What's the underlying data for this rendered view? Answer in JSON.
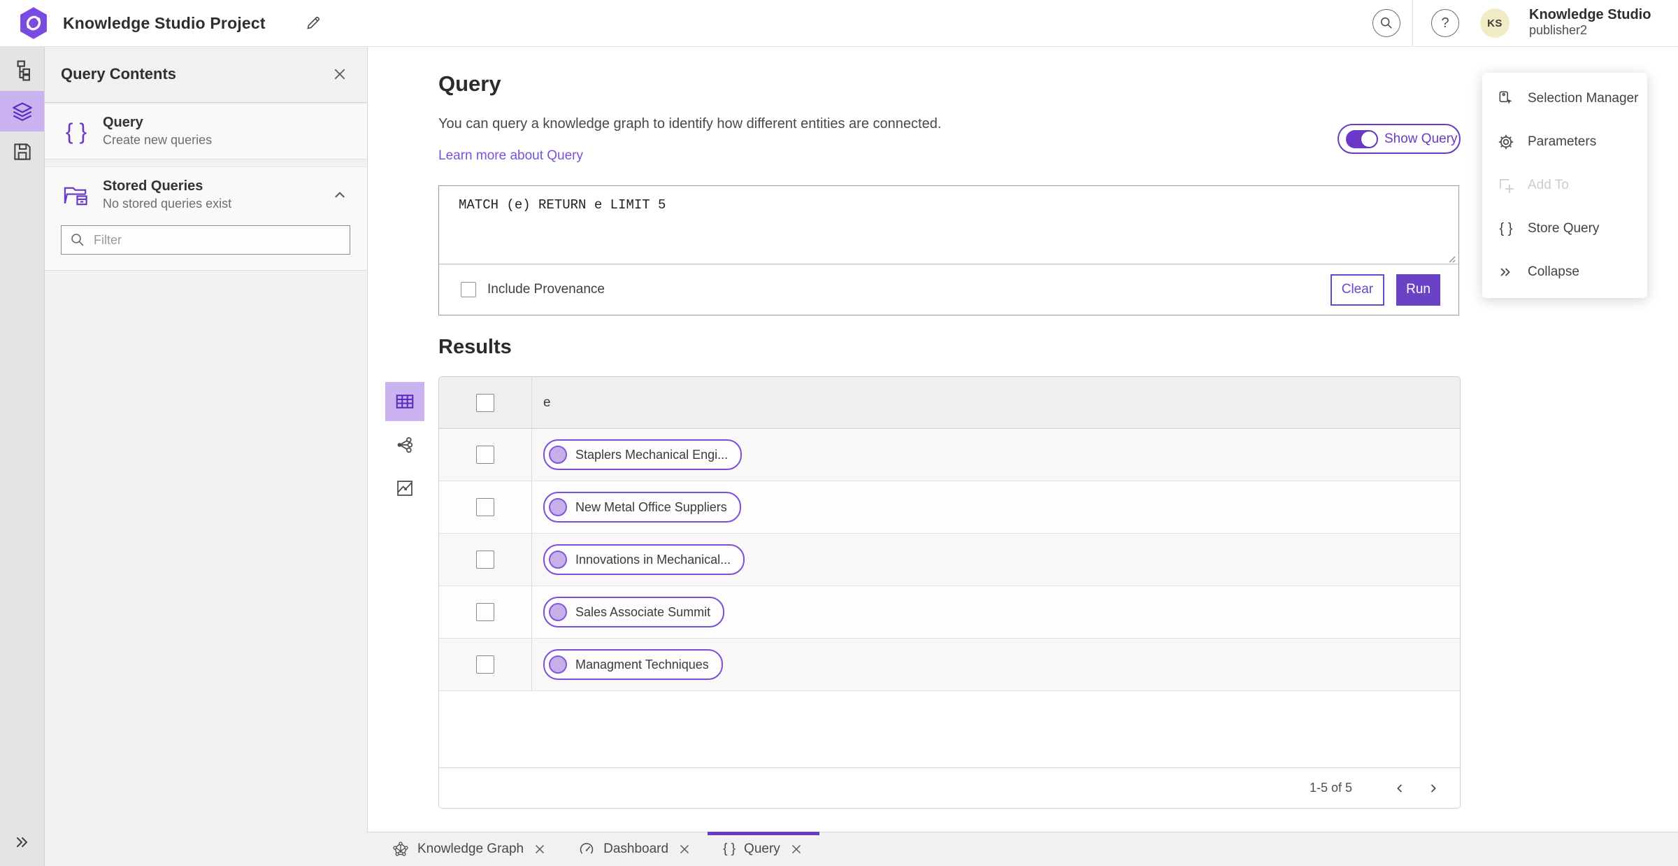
{
  "header": {
    "app_title": "Knowledge Studio Project",
    "user_name": "Knowledge Studio",
    "user_role": "publisher2",
    "avatar_initials": "KS"
  },
  "left_panel": {
    "title": "Query Contents",
    "query_item": {
      "title": "Query",
      "subtitle": "Create new queries"
    },
    "stored_item": {
      "title": "Stored Queries",
      "subtitle": "No stored queries exist"
    },
    "filter_placeholder": "Filter"
  },
  "query_section": {
    "title": "Query",
    "description": "You can query a knowledge graph to identify how different entities are connected.",
    "learn_more_label": "Learn more about Query",
    "show_query_label": "Show Query",
    "show_query_on": true,
    "query_text": "MATCH (e) RETURN e LIMIT 5",
    "include_provenance_label": "Include Provenance",
    "include_provenance_checked": false,
    "clear_label": "Clear",
    "run_label": "Run"
  },
  "results": {
    "title": "Results",
    "column_header": "e",
    "rows": [
      {
        "label": "Staplers Mechanical Engi..."
      },
      {
        "label": "New Metal Office Suppliers"
      },
      {
        "label": "Innovations in Mechanical..."
      },
      {
        "label": "Sales Associate Summit"
      },
      {
        "label": "Managment Techniques"
      }
    ],
    "pagination_label": "1-5 of 5"
  },
  "side_menu": {
    "items": [
      {
        "label": "Selection Manager",
        "disabled": false
      },
      {
        "label": "Parameters",
        "disabled": false
      },
      {
        "label": "Add To",
        "disabled": true
      },
      {
        "label": "Store Query",
        "disabled": false
      },
      {
        "label": "Collapse",
        "disabled": false
      }
    ]
  },
  "tabs": [
    {
      "label": "Knowledge Graph",
      "active": false
    },
    {
      "label": "Dashboard",
      "active": false
    },
    {
      "label": "Query",
      "active": true
    }
  ],
  "icons": {
    "braces": "{ }",
    "help": "?"
  },
  "colors": {
    "accent_purple": "#6a3ac6",
    "accent_light_bg": "#cbb3f2",
    "link_purple": "#7a52d9",
    "chip_border": "#7b4fd8",
    "chip_circle_fill": "#c7b0ea",
    "avatar_bg": "#f1ecc6",
    "run_button_bg": "#6a42c6"
  }
}
